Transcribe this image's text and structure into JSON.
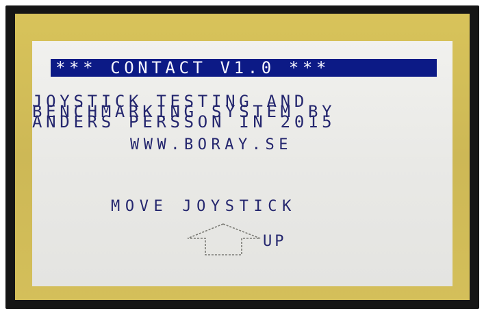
{
  "screen": {
    "title": "*** CONTACT V1.0 ***",
    "description": [
      "JOYSTICK TESTING AND",
      "BENCHMARKING SYSTEM BY",
      "ANDERS PERSSON IN 2015"
    ],
    "url": "WWW.BORAY.SE",
    "prompt": "MOVE JOYSTICK",
    "direction_label": "UP",
    "direction_icon": "arrow-up-icon"
  },
  "colors": {
    "bezel": "#151515",
    "border": "#d3be58",
    "background": "#ececea",
    "title_bar": "#0c1a86",
    "text": "#24266e",
    "arrow_outline": "#7a7a74"
  }
}
